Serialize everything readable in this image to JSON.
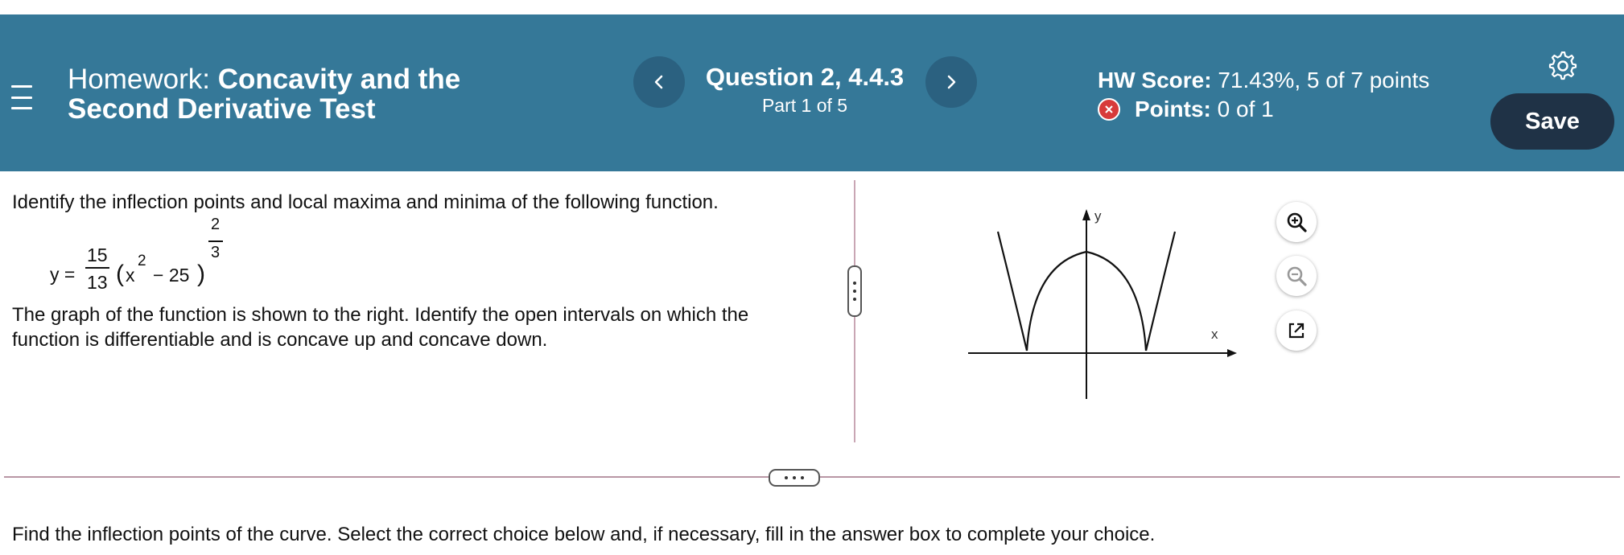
{
  "header": {
    "title_prefix": "Homework:",
    "title_main": "Concavity and the Second Derivative Test",
    "question_title": "Question 2, 4.4.3",
    "question_part": "Part 1 of 5",
    "hw_score_label": "HW Score:",
    "hw_score_value": "71.43%, 5 of 7 points",
    "points_label": "Points:",
    "points_value": "0 of 1",
    "save_label": "Save",
    "colors": {
      "bar": "#357898",
      "nav_button": "#2b6180",
      "save_button": "#1f3246",
      "wrong_badge": "#d73a3a"
    },
    "icons": {
      "menu": "hamburger-menu-icon",
      "prev": "chevron-left-icon",
      "next": "chevron-right-icon",
      "settings": "gear-icon",
      "wrong": "x-circle-icon"
    }
  },
  "question": {
    "instruction": "Identify the inflection points and local maxima and minima of the following function.",
    "formula": {
      "lhs": "y =",
      "coef_num": "15",
      "coef_den": "13",
      "open_paren": "(",
      "base": "x",
      "inner_exp": "2",
      "rest": "− 25",
      "close_paren": ")",
      "exp_num": "2",
      "exp_den": "3"
    },
    "graph_note": "The graph of the function is shown to the  right. Identify the open intervals on which the function is differentiable and is concave up and concave down.",
    "graph": {
      "x_label": "x",
      "y_label": "y"
    },
    "tools": {
      "zoom_in": "zoom-in-icon",
      "zoom_out": "zoom-out-icon",
      "popout": "popout-icon"
    }
  },
  "answer": {
    "prompt": "Find the inflection points of the curve. Select the correct choice below and, if necessary, fill in the answer box to complete your choice."
  }
}
